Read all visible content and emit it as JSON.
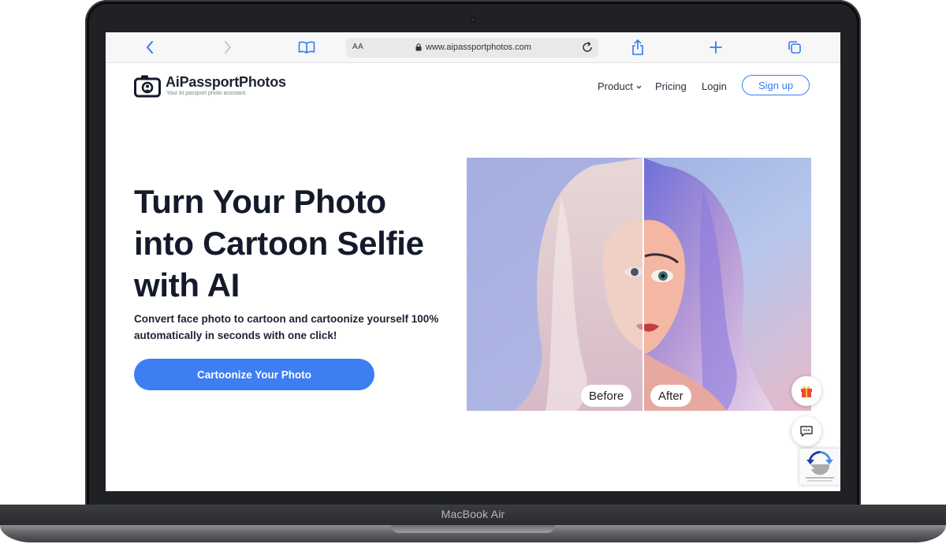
{
  "device": {
    "model_label": "MacBook Air"
  },
  "browser": {
    "text_size_button": "AA",
    "url": "www.aipassportphotos.com",
    "icons": {
      "back": "chevron-left-icon",
      "forward": "chevron-right-icon",
      "bookmarks": "book-icon",
      "reload": "reload-icon",
      "share": "share-icon",
      "new_tab": "plus-icon",
      "tabs": "tabs-icon"
    }
  },
  "site": {
    "brand": "AiPassportPhotos",
    "tagline": "Your AI passport photo assistant.",
    "nav": {
      "product": "Product",
      "pricing": "Pricing",
      "login": "Login",
      "signup": "Sign up"
    }
  },
  "hero": {
    "title_lines": [
      "Turn Your Photo",
      "into Cartoon Selfie",
      "with AI"
    ],
    "subtitle_lines": [
      "Convert face photo to cartoon and cartoonize yourself 100%",
      "automatically in seconds with one click!"
    ],
    "cta": "Cartoonize Your Photo",
    "compare": {
      "before_label": "Before",
      "after_label": "After"
    }
  },
  "widgets": {
    "gift": "gift-icon",
    "chat": "chat-icon",
    "captcha": "recaptcha-icon"
  },
  "colors": {
    "accent": "#3d7ef2",
    "heading": "#141a2b",
    "safari_blue": "#2f7bf5"
  }
}
